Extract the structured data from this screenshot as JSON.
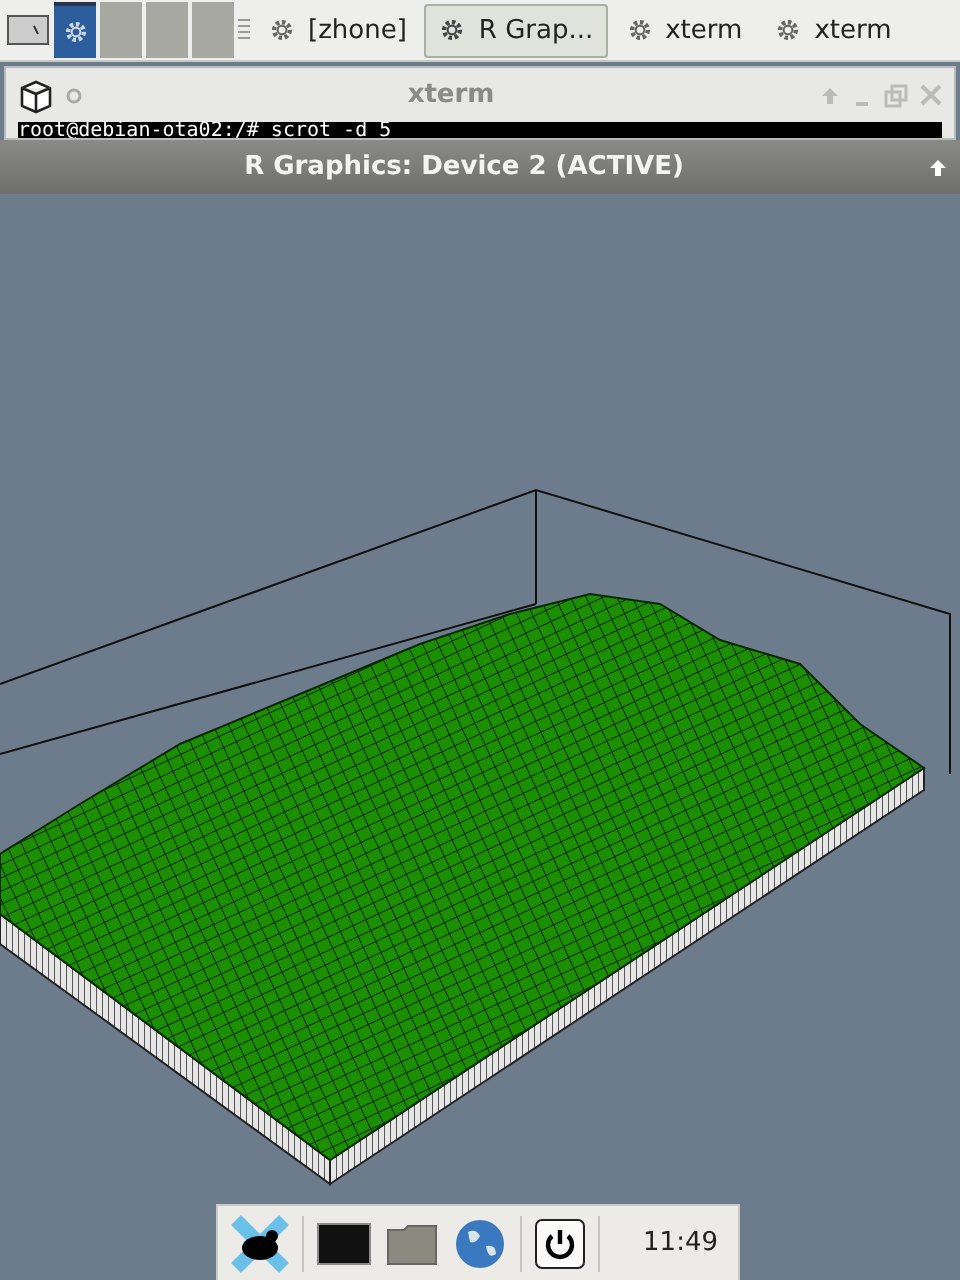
{
  "taskbar": {
    "workspaces": [
      {
        "selected": true
      },
      {
        "selected": false
      },
      {
        "selected": false
      },
      {
        "selected": false
      }
    ],
    "tasks": [
      {
        "label": "[zhone]",
        "selected": false
      },
      {
        "label": "R Grap...",
        "selected": true
      },
      {
        "label": "xterm",
        "selected": false
      },
      {
        "label": "xterm",
        "selected": false
      }
    ]
  },
  "xterm_window": {
    "title": "xterm",
    "terminal_line": "root@debian-ota02:/# scrot -d 5"
  },
  "graphics_window": {
    "title": "R Graphics: Device 2 (ACTIVE)"
  },
  "dock": {
    "clock": "11:49"
  }
}
